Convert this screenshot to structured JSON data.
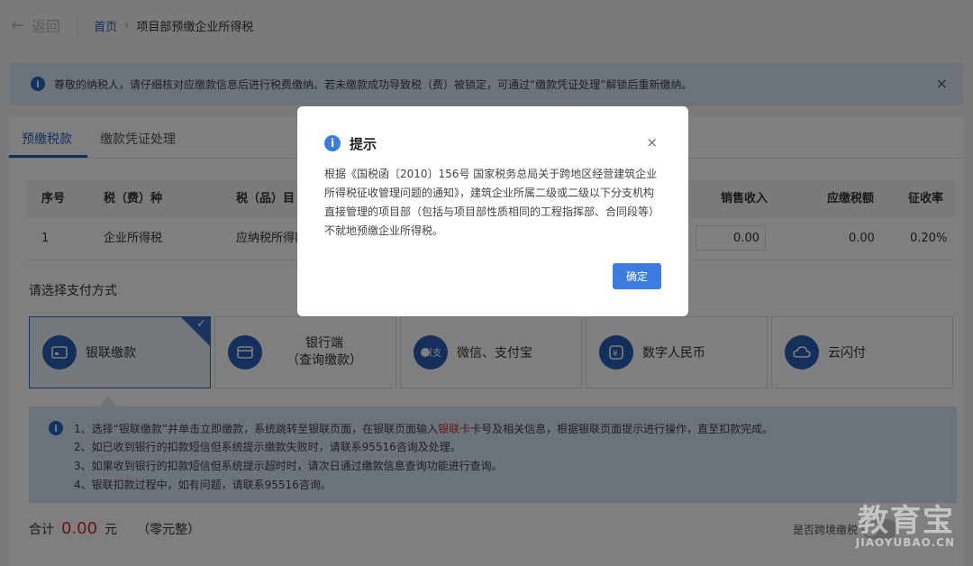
{
  "header": {
    "back_label": "返回",
    "breadcrumb_home": "首页",
    "breadcrumb_separator": "›",
    "breadcrumb_current": "项目部预缴企业所得税"
  },
  "notice": {
    "text": "尊敬的纳税人，请仔细核对应缴款信息后进行税费缴纳。若未缴款成功导致税（费）被锁定，可通过“缴款凭证处理”解锁后重新缴纳。",
    "close": "×"
  },
  "tabs": [
    {
      "label": "预缴税款",
      "active": true
    },
    {
      "label": "缴款凭证处理",
      "active": false
    }
  ],
  "table": {
    "headers": [
      "序号",
      "税（费）种",
      "税（品）目",
      "销售收入",
      "应缴税额",
      "征收率"
    ],
    "row": {
      "index": "1",
      "tax_type": "企业所得税",
      "tax_item": "应纳税所得额",
      "sales": "0.00",
      "tax_due": "0.00",
      "rate": "0.20%"
    }
  },
  "payment": {
    "title": "请选择支付方式",
    "options": [
      {
        "label": "银联缴款",
        "icon": "bank-card-icon",
        "selected": true
      },
      {
        "label": "银行端",
        "label2": "（查询缴款）",
        "icon": "wallet-icon",
        "selected": false
      },
      {
        "label": "微信、支付宝",
        "icon": "wechat-alipay-icon",
        "selected": false
      },
      {
        "label": "数字人民币",
        "icon": "digital-rmb-icon",
        "selected": false
      },
      {
        "label": "云闪付",
        "icon": "cloud-pay-icon",
        "selected": false
      }
    ],
    "check": "✓"
  },
  "help": {
    "line1_pre": "1、选择“银联缴款”并单击立即缴款，系统跳转至银联页面，在银联页面输入",
    "line1_red": "银联卡",
    "line1_post": "卡号及相关信息，根据银联页面提示进行操作，直至扣款完成。",
    "line2": "2、如已收到银行的扣款短信但系统提示缴款失败时，请联系95516咨询及处理。",
    "line3": "3、如果收到银行的扣款短信但系统提示超时时，请次日通过缴款信息查询功能进行查询。",
    "line4": "4、银联扣款过程中，如有问题，请联系95516咨询。"
  },
  "footer": {
    "total_label": "合计",
    "total_amount": "0.00",
    "currency": "元",
    "amount_words": "（零元整）",
    "cross_region_label": "是否跨境缴税"
  },
  "modal": {
    "title": "提示",
    "close": "×",
    "body": "根据《国税函〔2010〕156号 国家税务总局关于跨地区经营建筑企业所得税征收管理问题的通知》，建筑企业所属二级或二级以下分支机构直接管理的项目部（包括与项目部性质相同的工程指挥部、合同段等）不就地预缴企业所得税。",
    "ok_label": "确定"
  },
  "watermark": {
    "line1": "教育宝",
    "line2": "JIAOYUBAO.CN"
  },
  "colors": {
    "accent": "#2b5fb8",
    "notice_bg": "#dbe6f6",
    "amount_red": "#d7282f",
    "button_blue": "#3c7be0"
  }
}
